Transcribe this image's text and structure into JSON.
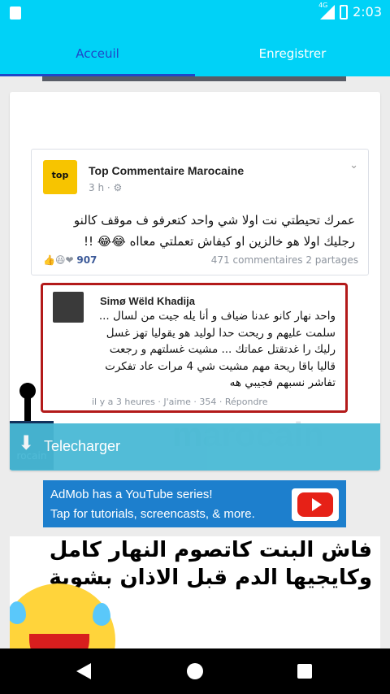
{
  "status": {
    "time": "2:03",
    "network": "4G"
  },
  "tabs": [
    {
      "label": "Acceuil"
    },
    {
      "label": "Enregistrer"
    }
  ],
  "colors": {
    "primary": "#00d2f7",
    "tab_active": "#1f46c8",
    "ad_blue": "#1d7fcd",
    "download_bar": "#49b9d5"
  },
  "post": {
    "page_name": "Top Commentaire Marocaine",
    "time": "3 h · ",
    "text": "عمرك تحيطتي نت اولا شي واحد كتعرفو ف موقف كالنو رجليك اولا هو خالزين او كيفاش تعملتي معااه 😂😂 !!",
    "reactions_count": "907",
    "stats": "471 commentaires 2 partages",
    "logo_label": "top"
  },
  "comment": {
    "author": "Simø Wëld Khadija",
    "text": "واحد نهار كانو عدنا ضياف و أنا يله جيت من لسال ... سلمت عليهم و ريحت حدا لوليد هو يقوليا تهز غسل رليك را غدتقتل عماتك ... مشيت غسلتهم و رجعت قاليا باقا ريحة مهم مشيت شي 4 مرات عاد تفكرت تفاشر نسبهم فجيبي هه",
    "footer": "il y a 3 heures · J'aime · 354 · Répondre"
  },
  "watermark": {
    "text": "marocain",
    "tag": "rocain"
  },
  "download": {
    "label": "Telecharger"
  },
  "ad": {
    "line1": "AdMob has a YouTube series!",
    "line2": "Tap for tutorials, screencasts, & more."
  },
  "second_card": {
    "text": "فاش البنت كاتصوم النهار كامل وكايجيها الدم قبل الاذان بشوية"
  }
}
